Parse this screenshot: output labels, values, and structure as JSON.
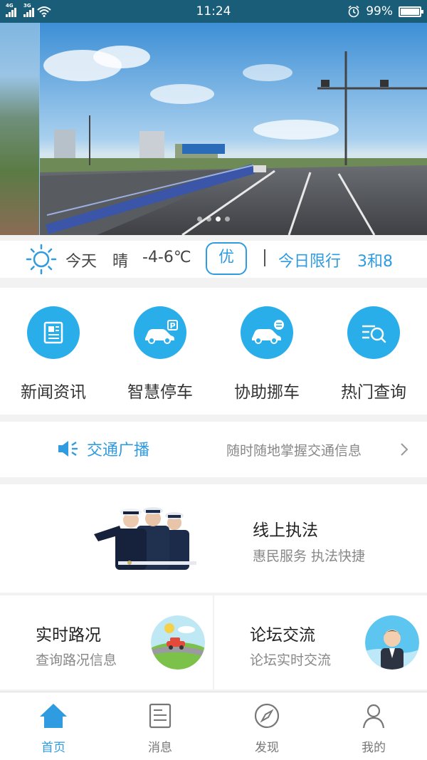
{
  "status_bar": {
    "signal1_tag": "4G",
    "signal2_tag": "3G",
    "time": "11:24",
    "battery_text": "99%",
    "battery_level": 0.99
  },
  "banner": {
    "slide_count": 4,
    "active_index": 2
  },
  "weather": {
    "icon": "sun-icon",
    "today_label": "今天",
    "condition": "晴",
    "temperature": "-4-6℃",
    "air_quality": "优",
    "restriction_label": "今日限行",
    "restriction_value": "3和8"
  },
  "quick_functions": [
    {
      "label": "新闻资讯",
      "icon": "newspaper-icon"
    },
    {
      "label": "智慧停车",
      "icon": "parking-car-icon"
    },
    {
      "label": "协助挪车",
      "icon": "move-car-icon"
    },
    {
      "label": "热门查询",
      "icon": "search-list-icon"
    }
  ],
  "broadcast": {
    "icon": "speaker-icon",
    "title": "交通广播",
    "description": "随时随地掌握交通信息"
  },
  "enforcement": {
    "title": "线上执法",
    "subtitle": "惠民服务 执法快捷"
  },
  "cards": [
    {
      "title": "实时路况",
      "subtitle": "查询路况信息"
    },
    {
      "title": "论坛交流",
      "subtitle": "论坛实时交流"
    }
  ],
  "tabbar": [
    {
      "label": "首页",
      "icon": "home-icon",
      "active": true
    },
    {
      "label": "消息",
      "icon": "message-icon",
      "active": false
    },
    {
      "label": "发现",
      "icon": "compass-icon",
      "active": false
    },
    {
      "label": "我的",
      "icon": "person-icon",
      "active": false
    }
  ],
  "colors": {
    "accent": "#2f9be0",
    "icon_circle": "#2aaeea",
    "status_bar": "#1a5d78"
  }
}
